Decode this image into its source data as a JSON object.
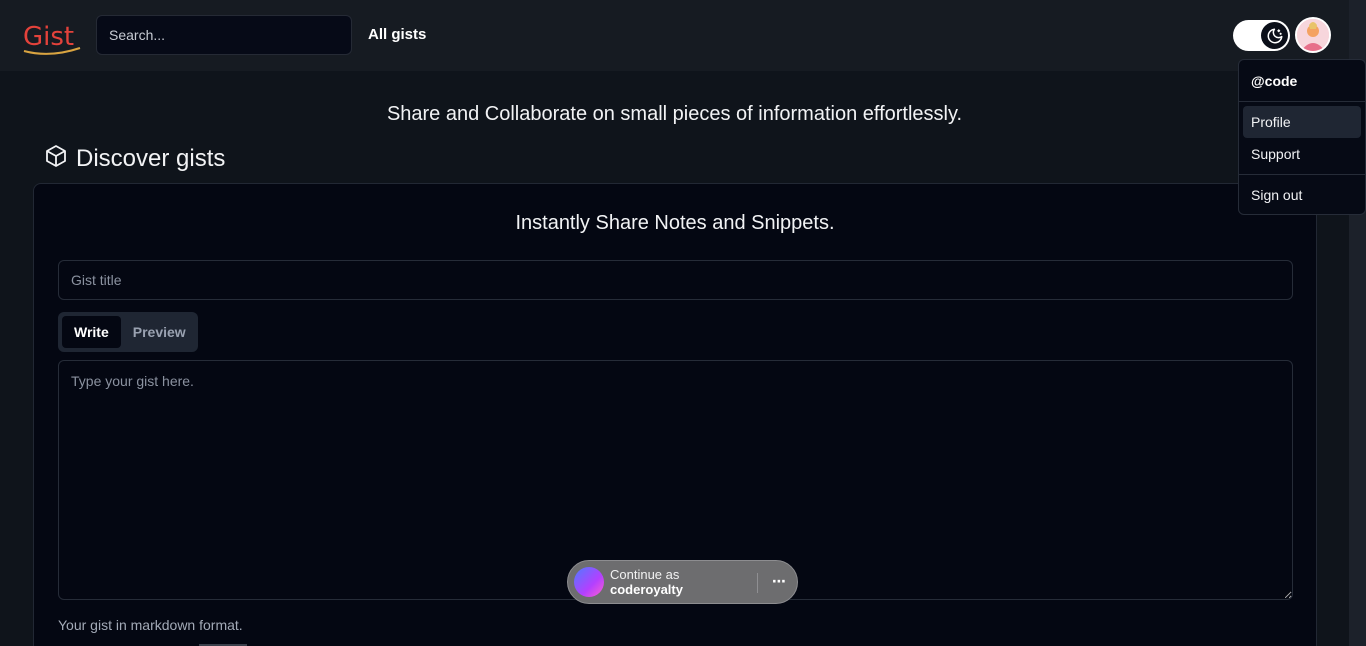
{
  "header": {
    "logo_text": "Gist",
    "search_placeholder": "Search...",
    "nav_all_gists": "All gists"
  },
  "hero": {
    "tagline": "Share and Collaborate on small pieces of information effortlessly."
  },
  "discover": {
    "label": "Discover gists"
  },
  "editor": {
    "title": "Instantly Share Notes and Snippets.",
    "title_placeholder": "Gist title",
    "tabs": [
      {
        "label": "Write",
        "active": true
      },
      {
        "label": "Preview",
        "active": false
      }
    ],
    "body_placeholder": "Type your gist here.",
    "hint": "Your gist in markdown format."
  },
  "user_menu": {
    "username": "@code",
    "items": [
      {
        "label": "Profile"
      },
      {
        "label": "Support"
      },
      {
        "label": "Sign out"
      }
    ]
  },
  "continue_prompt": {
    "line1": "Continue as",
    "line2": "coderoyalty",
    "more_label": "⋯"
  },
  "colors": {
    "page_bg": "#0f141b",
    "header_bg": "#161b22",
    "card_bg": "#040712",
    "border": "#262c38",
    "tab_group_bg": "#1f2633"
  },
  "icons": {
    "discover": "cube-icon",
    "theme": "moon-stars-icon",
    "more": "ellipsis-icon"
  }
}
